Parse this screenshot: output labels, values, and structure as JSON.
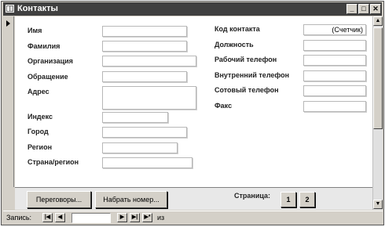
{
  "window": {
    "title": "Контакты",
    "minimize_glyph": "_",
    "maximize_glyph": "□",
    "close_glyph": "✕"
  },
  "left_labels": {
    "first_name": "Имя",
    "last_name": "Фамилия",
    "organization": "Организация",
    "salutation": "Обращение",
    "address": "Адрес",
    "postal_code": "Индекс",
    "city": "Город",
    "region": "Регион",
    "country": "Страна/регион"
  },
  "right_labels": {
    "contact_id": "Код контакта",
    "job_title": "Должность",
    "work_phone": "Рабочий телефон",
    "extension": "Внутренний телефон",
    "mobile_phone": "Сотовый телефон",
    "fax": "Факс"
  },
  "fields": {
    "contact_id_value": "(Счетчик)"
  },
  "footer": {
    "calls_button": "Переговоры...",
    "dial_button": "Набрать номер...",
    "page_label": "Страница:",
    "page1": "1",
    "page2": "2"
  },
  "record_nav": {
    "label": "Запись:",
    "first_glyph": "|◀",
    "prev_glyph": "◀",
    "current_value": "",
    "next_glyph": "▶",
    "last_glyph": "▶|",
    "new_glyph": "▶*",
    "of_label": "из"
  },
  "scrollbar": {
    "up_glyph": "▲",
    "down_glyph": "▼"
  }
}
